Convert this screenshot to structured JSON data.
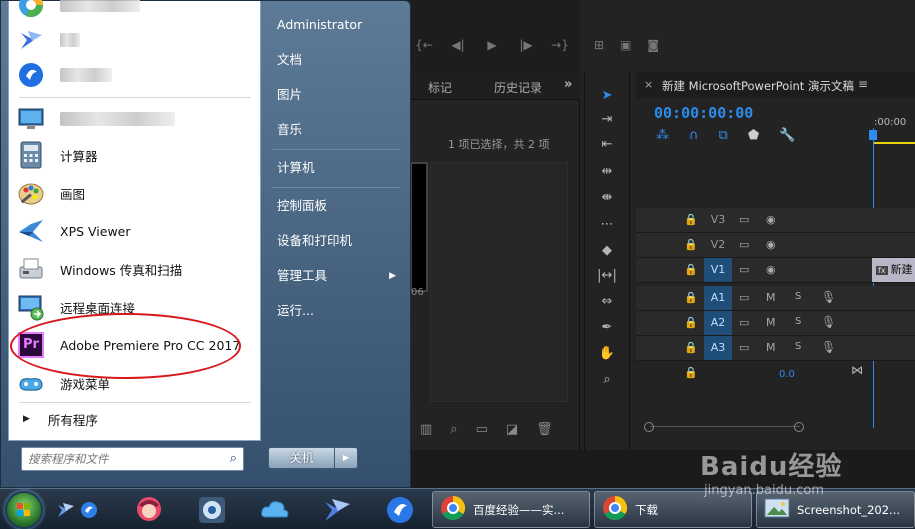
{
  "premiere": {
    "project_tabs": [
      "标记",
      "历史记录"
    ],
    "more_label": "»",
    "selection_text": "1 项已选择，共 2 项",
    "thumb_number": "06",
    "timeline": {
      "close": "×",
      "title": "新建 MicrosoftPowerPoint 演示文稿",
      "menu": "≡",
      "timecode": "00:00:00:00",
      "ruler_time": ":00:00",
      "tracks": [
        {
          "name": "V3",
          "type": "video",
          "selected": false
        },
        {
          "name": "V2",
          "type": "video",
          "selected": false
        },
        {
          "name": "V1",
          "type": "video",
          "selected": true
        },
        {
          "name": "A1",
          "type": "audio",
          "selected": true
        },
        {
          "name": "A2",
          "type": "audio",
          "selected": true
        },
        {
          "name": "A3",
          "type": "audio",
          "selected": true
        }
      ],
      "audio_m": "M",
      "audio_s": "S",
      "clip_label": "新建",
      "clip_fx": "fx",
      "volume_value": "0.0"
    }
  },
  "startmenu": {
    "programs": [
      {
        "label": "",
        "icon": "browser-icon",
        "blurred": true
      },
      {
        "label": "",
        "icon": "bird-icon",
        "blurred": true
      },
      {
        "label": "",
        "icon": "chat-icon",
        "blurred": true
      },
      {
        "label": "",
        "icon": "monitor-icon",
        "blurred": true
      },
      {
        "label": "计算器",
        "icon": "calculator-icon",
        "blurred": false
      },
      {
        "label": "画图",
        "icon": "paint-icon",
        "blurred": false
      },
      {
        "label": "XPS Viewer",
        "icon": "xps-icon",
        "blurred": false
      },
      {
        "label": "Windows 传真和扫描",
        "icon": "fax-icon",
        "blurred": false
      },
      {
        "label": "远程桌面连接",
        "icon": "remote-icon",
        "blurred": false
      },
      {
        "label": "Adobe Premiere Pro CC 2017",
        "icon": "premiere-icon",
        "blurred": false
      },
      {
        "label": "游戏菜单",
        "icon": "game-icon",
        "blurred": false
      }
    ],
    "premiere_icon_text": "Pr",
    "all_programs": "所有程序",
    "search_placeholder": "搜索程序和文件",
    "right_items": [
      {
        "label": "Administrator",
        "arrow": false
      },
      {
        "label": "文档",
        "arrow": false
      },
      {
        "label": "图片",
        "arrow": false
      },
      {
        "label": "音乐",
        "arrow": false
      },
      {
        "label": "计算机",
        "arrow": false
      },
      {
        "label": "控制面板",
        "arrow": false
      },
      {
        "label": "设备和打印机",
        "arrow": false
      },
      {
        "label": "管理工具",
        "arrow": true
      },
      {
        "label": "运行...",
        "arrow": false
      }
    ],
    "shutdown_label": "关机"
  },
  "taskbar": {
    "buttons": [
      {
        "label": "百度经验——实...",
        "icon": "chrome-icon"
      },
      {
        "label": "下载",
        "icon": "chrome-icon"
      },
      {
        "label": "Screenshot_202...",
        "icon": "image-icon"
      }
    ]
  },
  "watermark": {
    "main": "Baidu经验",
    "sub": "jingyan.baidu.com"
  },
  "colors": {
    "accent": "#2d8ceb",
    "highlight_circle": "#d7191c",
    "premiere_bg": "#232323"
  }
}
